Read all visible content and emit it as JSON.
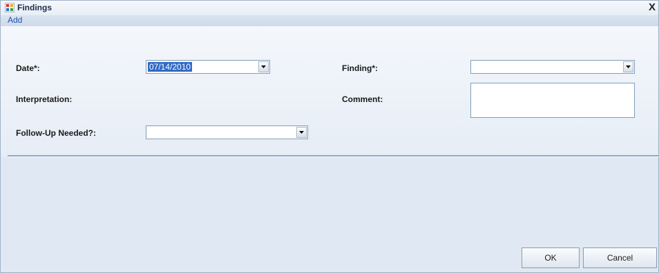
{
  "window": {
    "title": "Findings",
    "close_glyph": "X",
    "mode": "Add"
  },
  "form": {
    "date": {
      "label": "Date*:",
      "value": "07/14/2010"
    },
    "interpretation": {
      "label": "Interpretation:"
    },
    "follow_up": {
      "label": "Follow-Up Needed?:",
      "value": ""
    },
    "finding": {
      "label": "Finding*:",
      "value": ""
    },
    "comment": {
      "label": "Comment:",
      "value": ""
    }
  },
  "buttons": {
    "ok": "OK",
    "cancel": "Cancel"
  },
  "colors": {
    "selection": "#316ac5",
    "mode_text": "#1f4fa8",
    "background": "#dfe8f3"
  }
}
